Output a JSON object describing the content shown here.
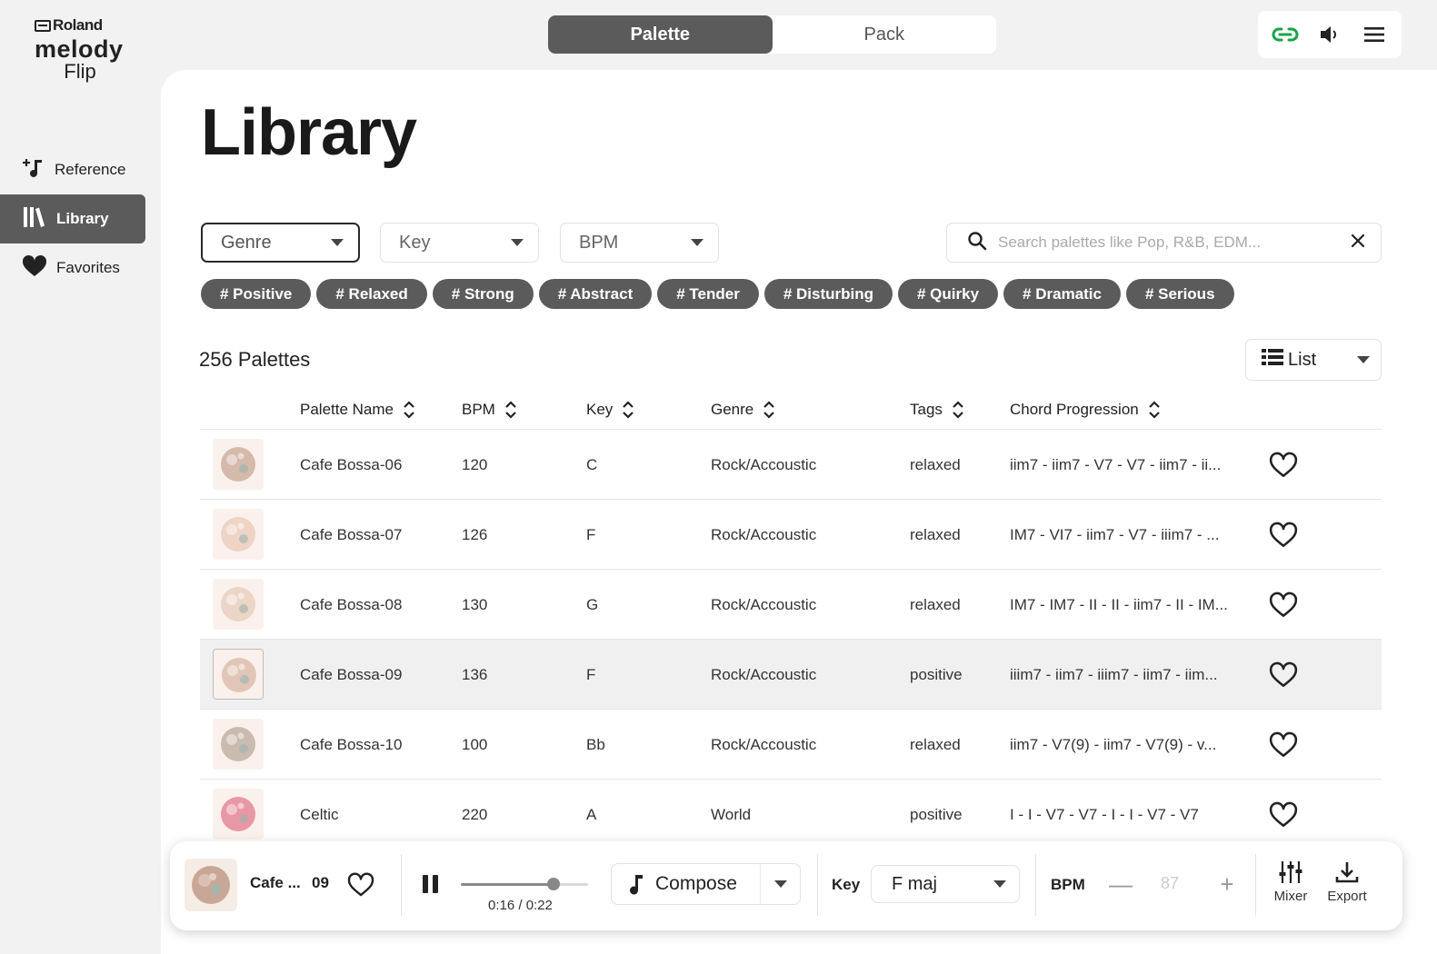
{
  "app": {
    "brand": "Roland",
    "logo_line1": "melody",
    "logo_line2": "Flip"
  },
  "sidebar": {
    "items": [
      {
        "label": "Reference",
        "icon": "music-note-plus-icon",
        "active": false
      },
      {
        "label": "Library",
        "icon": "library-icon",
        "active": true
      },
      {
        "label": "Favorites",
        "icon": "heart-filled-icon",
        "active": false
      }
    ]
  },
  "topbar": {
    "segments": [
      {
        "label": "Palette",
        "active": true
      },
      {
        "label": "Pack",
        "active": false
      }
    ],
    "icons": [
      "link-icon",
      "speaker-icon",
      "menu-icon"
    ],
    "link_color": "#1aa34a"
  },
  "main": {
    "title": "Library",
    "filters": {
      "genre": "Genre",
      "key": "Key",
      "bpm": "BPM"
    },
    "search": {
      "placeholder": "Search palettes like Pop, R&B, EDM..."
    },
    "tags": [
      "# Positive",
      "# Relaxed",
      "# Strong",
      "# Abstract",
      "# Tender",
      "# Disturbing",
      "# Quirky",
      "# Dramatic",
      "# Serious"
    ],
    "count": "256 Palettes",
    "view": "List"
  },
  "table": {
    "columns": {
      "name": "Palette Name",
      "bpm": "BPM",
      "key": "Key",
      "genre": "Genre",
      "tags": "Tags",
      "chords": "Chord Progression"
    },
    "rows": [
      {
        "name": "Cafe Bossa-06",
        "bpm": "120",
        "key": "C",
        "genre": "Rock/Accoustic",
        "tags": "relaxed",
        "chords": "iim7 - iim7 - V7 - V7 - iim7 - ii...",
        "thumb_color": "#c8a696",
        "highlight": false
      },
      {
        "name": "Cafe Bossa-07",
        "bpm": "126",
        "key": "F",
        "genre": "Rock/Accoustic",
        "tags": "relaxed",
        "chords": "IM7 - VI7 - iim7 - V7 - iiim7 - ...",
        "thumb_color": "#e8c9b8",
        "highlight": false
      },
      {
        "name": "Cafe Bossa-08",
        "bpm": "130",
        "key": "G",
        "genre": "Rock/Accoustic",
        "tags": "relaxed",
        "chords": "IM7 - IM7 - II - II - iim7 - II - IM...",
        "thumb_color": "#e6cbb9",
        "highlight": false
      },
      {
        "name": "Cafe Bossa-09",
        "bpm": "136",
        "key": "F",
        "genre": "Rock/Accoustic",
        "tags": "positive",
        "chords": "iiim7 - iim7 - iiim7 - iim7 - iim...",
        "thumb_color": "#d8b7a6",
        "highlight": true
      },
      {
        "name": "Cafe Bossa-10",
        "bpm": "100",
        "key": "Bb",
        "genre": "Rock/Accoustic",
        "tags": "relaxed",
        "chords": "iim7 - V7(9) - iim7 - V7(9) - v...",
        "thumb_color": "#b8a89a",
        "highlight": false
      },
      {
        "name": "Celtic",
        "bpm": "220",
        "key": "A",
        "genre": "World",
        "tags": "positive",
        "chords": "I - I - V7 - V7 - I - I - V7 - V7",
        "thumb_color": "#e27a8c",
        "highlight": false
      }
    ]
  },
  "player": {
    "name": "Cafe ...",
    "number": "09",
    "time": "0:16 / 0:22",
    "progress": 0.73,
    "compose_label": "Compose",
    "key_label": "Key",
    "key_value": "F maj",
    "bpm_label": "BPM",
    "bpm_value": "87",
    "minus": "—",
    "plus": "+",
    "mixer": "Mixer",
    "export": "Export"
  }
}
